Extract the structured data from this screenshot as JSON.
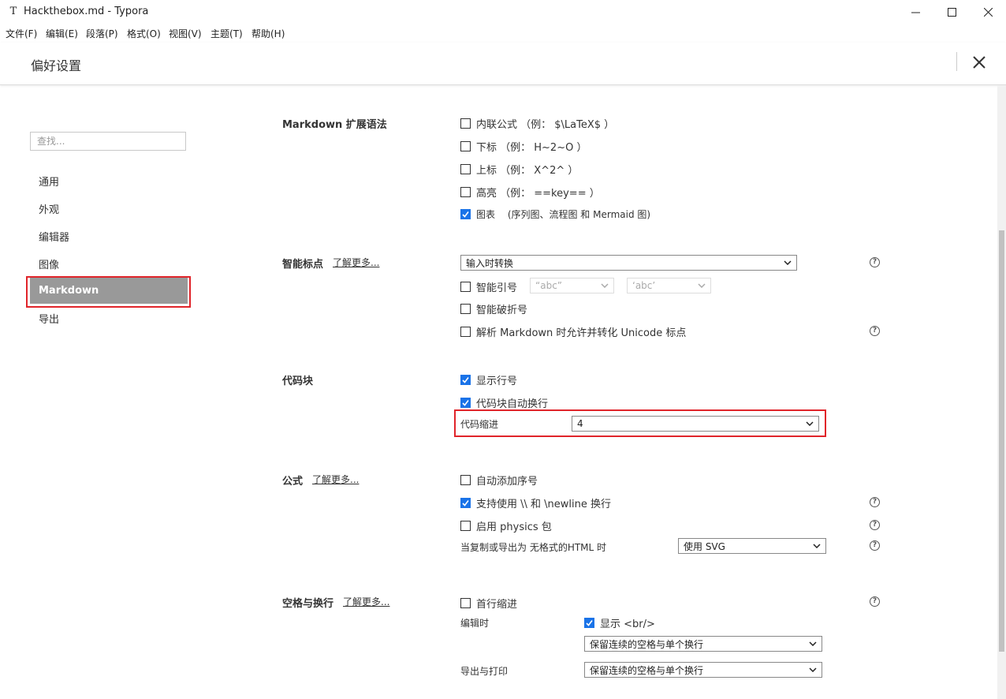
{
  "window": {
    "title": "Hackthebox.md - Typora",
    "app_icon": "T"
  },
  "menu": [
    "文件(F)",
    "编辑(E)",
    "段落(P)",
    "格式(O)",
    "视图(V)",
    "主题(T)",
    "帮助(H)"
  ],
  "prefs": {
    "title": "偏好设置"
  },
  "sidebar": {
    "search_placeholder": "查找...",
    "items": [
      "通用",
      "外观",
      "编辑器",
      "图像",
      "Markdown",
      "导出"
    ]
  },
  "markdown_ext": {
    "title": "Markdown 扩展语法",
    "options": [
      {
        "label": "内联公式 （例： $\\LaTeX$ ）",
        "checked": false
      },
      {
        "label": "下标 （例： H~2~O ）",
        "checked": false
      },
      {
        "label": "上标 （例： X^2^ ）",
        "checked": false
      },
      {
        "label": "高亮 （例： ==key== ）",
        "checked": false
      },
      {
        "label": "图表 　(序列图、流程图 和 Mermaid 图)",
        "checked": true
      }
    ]
  },
  "smart_punct": {
    "title": "智能标点",
    "learn_more": "了解更多...",
    "mode": "输入时转换",
    "smart_quotes": {
      "label": "智能引号",
      "checked": false,
      "double": "“abc”",
      "single": "‘abc’"
    },
    "smart_dash": {
      "label": "智能破折号",
      "checked": false
    },
    "unicode": {
      "label": "解析 Markdown 时允许并转化 Unicode 标点",
      "checked": false
    }
  },
  "code_block": {
    "title": "代码块",
    "line_numbers": {
      "label": "显示行号",
      "checked": true
    },
    "wrap": {
      "label": "代码块自动换行",
      "checked": true
    },
    "indent_label": "代码缩进",
    "indent_value": "4"
  },
  "math": {
    "title": "公式",
    "learn_more": "了解更多...",
    "auto_number": {
      "label": "自动添加序号",
      "checked": false
    },
    "newline": {
      "label": "支持使用 \\\\ 和 \\newline 换行",
      "checked": true
    },
    "physics": {
      "label": "启用 physics 包",
      "checked": false
    },
    "export_label": "当复制或导出为 无格式的HTML 时",
    "export_value": "使用 SVG"
  },
  "whitespace": {
    "title": "空格与换行",
    "learn_more": "了解更多...",
    "indent_first": {
      "label": "首行缩进",
      "checked": false
    },
    "editing_label": "编辑时",
    "show_br": {
      "label": "显示 <br/>",
      "checked": true
    },
    "editing_value": "保留连续的空格与单个换行",
    "export_label": "导出与打印",
    "export_value": "保留连续的空格与单个换行"
  },
  "colors": {
    "accent": "#1a73e8",
    "highlight_border": "#e0242a",
    "nav_active_bg": "#999999"
  }
}
